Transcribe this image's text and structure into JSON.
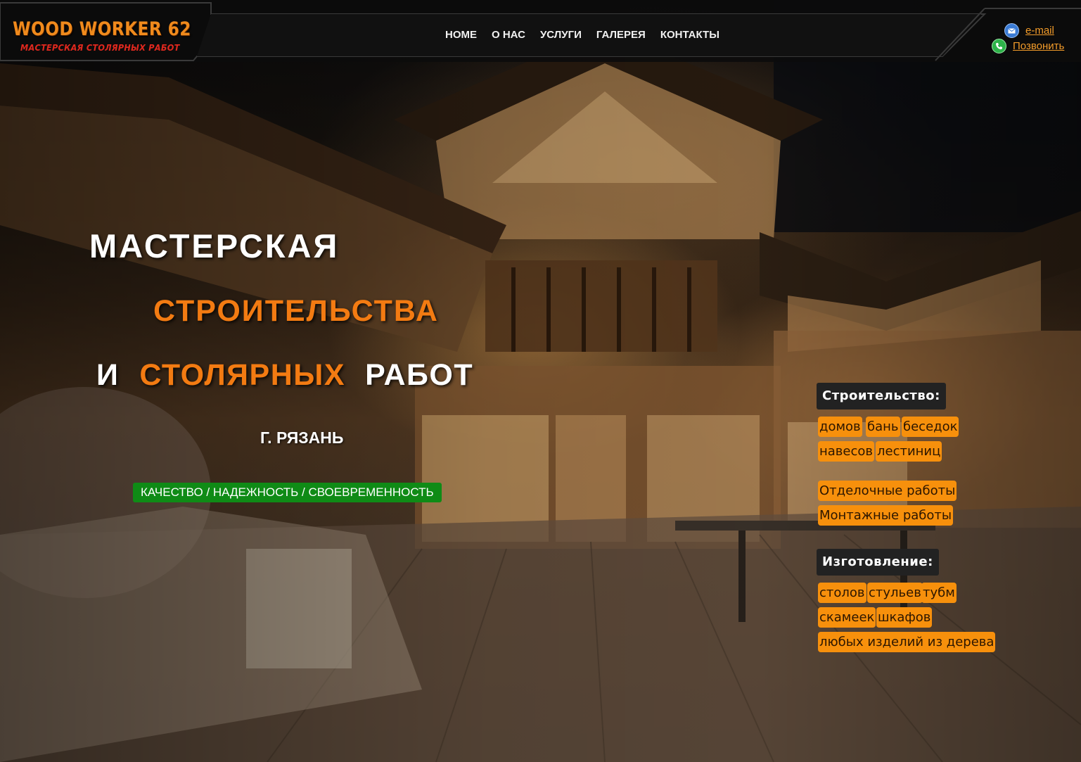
{
  "header": {
    "logo_title": "WOOD WORKER 62",
    "logo_subtitle": "МАСТЕРСКАЯ СТОЛЯРНЫХ РАБОТ",
    "nav": [
      {
        "label": "HOME"
      },
      {
        "label": "О НАС"
      },
      {
        "label": "УСЛУГИ"
      },
      {
        "label": "ГАЛЕРЕЯ"
      },
      {
        "label": "КОНТАКТЫ"
      }
    ],
    "contacts": {
      "email_label": "e-mail",
      "email_icon": "envelope-icon",
      "phone_label": "Позвонить",
      "phone_icon": "phone-icon"
    }
  },
  "hero": {
    "line1": "МАСТЕРСКАЯ",
    "line2": "СТРОИТЕЛЬСТВА",
    "line3_a": "И",
    "line3_b": "СТОЛЯРНЫХ",
    "line3_c": "РАБОТ",
    "city": "Г. РЯЗАНЬ",
    "slogan": "КАЧЕСТВО / НАДЕЖНОСТЬ / СВОЕВРЕМЕННОСТЬ"
  },
  "services": {
    "construction_title": "Строительство:",
    "construction_items": [
      "домов",
      "бань",
      "беседок",
      "навесов",
      "лестиниц"
    ],
    "finishing": "Отделочные работы",
    "mounting": "Монтажные работы",
    "manufacturing_title": "Изготовление:",
    "manufacturing_items": [
      "столов",
      "стульев",
      "тубм",
      "скамеек",
      "шкафов",
      "любых изделий из дерева"
    ]
  },
  "colors": {
    "accent_orange": "#f37b12",
    "tag_orange": "#f7900c",
    "slogan_green": "#0f8b16",
    "header_bg": "#0c0c0c"
  }
}
